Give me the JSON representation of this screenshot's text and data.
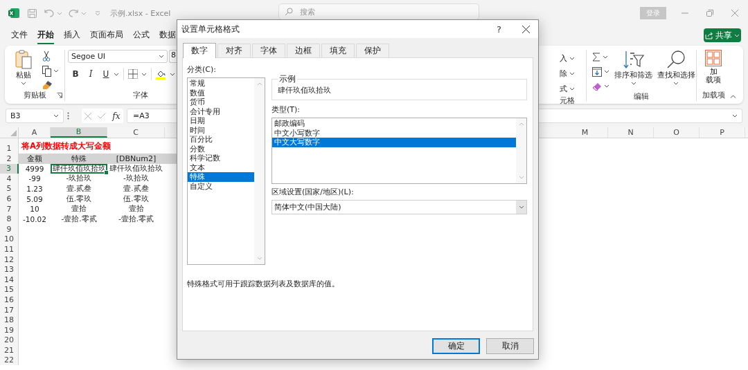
{
  "title_bar": {
    "file_title": "示例.xlsx - Excel",
    "search": {
      "placeholder": "搜索"
    },
    "sign_in_button": "登录"
  },
  "ribbon_tabs": [
    {
      "label": "文件",
      "selected": false
    },
    {
      "label": "开始",
      "selected": true
    },
    {
      "label": "插入",
      "selected": false
    },
    {
      "label": "页面布局",
      "selected": false
    },
    {
      "label": "公式",
      "selected": false
    },
    {
      "label": "数据",
      "selected": false
    }
  ],
  "share_button": "共享",
  "ribbon": {
    "clipboard": {
      "paste_button": "粘贴",
      "label": "剪贴板"
    },
    "font": {
      "font_name": "Segoe UI",
      "font_size": "8",
      "bold_button": "B",
      "italic_button": "I",
      "underline_button": "U",
      "label": "字体"
    },
    "cells": {
      "buttons": [
        "入",
        "除",
        "式"
      ],
      "label": "元格"
    },
    "editing": {
      "sort_filter_button": "排序和筛选",
      "find_select_button": "查找和选择",
      "label": "编辑"
    },
    "addins": {
      "button_lines": [
        "加",
        "载项"
      ],
      "label": "加载项"
    }
  },
  "formula_bar": {
    "name_box": "B3",
    "fx_button": "fx",
    "formula": "=A3"
  },
  "sheet": {
    "columns_left": [
      {
        "label": "A",
        "selected": false
      },
      {
        "label": "B",
        "selected": true
      },
      {
        "label": "C",
        "selected": false
      }
    ],
    "columns_right": [
      {
        "label": "M",
        "selected": false
      },
      {
        "label": "N",
        "selected": false
      },
      {
        "label": "O",
        "selected": false
      },
      {
        "label": "P",
        "selected": false
      }
    ],
    "rows": [
      {
        "number": "1",
        "selected": false,
        "kind": "title",
        "title": "将A列数据转成大写金额"
      },
      {
        "number": "2",
        "selected": false,
        "kind": "header",
        "cells": [
          {
            "text": "金额",
            "selected": false
          },
          {
            "text": "特殊",
            "selected": false
          },
          {
            "text": "[DBNum2]",
            "selected": false
          }
        ]
      },
      {
        "number": "3",
        "selected": true,
        "kind": "data",
        "cells": [
          {
            "text": "4999",
            "selected": false
          },
          {
            "text": "肆仟玖佰玖拾玖",
            "selected": true
          },
          {
            "text": "肆仟玖佰玖拾玖",
            "selected": false
          }
        ]
      },
      {
        "number": "4",
        "selected": false,
        "kind": "data",
        "cells": [
          {
            "text": "-99",
            "selected": false
          },
          {
            "text": "-玖拾玖",
            "selected": false
          },
          {
            "text": "-玖拾玖",
            "selected": false
          }
        ]
      },
      {
        "number": "5",
        "selected": false,
        "kind": "data",
        "cells": [
          {
            "text": "1.23",
            "selected": false
          },
          {
            "text": "壹.贰叁",
            "selected": false
          },
          {
            "text": "壹.贰叁",
            "selected": false
          }
        ]
      },
      {
        "number": "6",
        "selected": false,
        "kind": "data",
        "cells": [
          {
            "text": "5.09",
            "selected": false
          },
          {
            "text": "伍.零玖",
            "selected": false
          },
          {
            "text": "伍.零玖",
            "selected": false
          }
        ]
      },
      {
        "number": "7",
        "selected": false,
        "kind": "data",
        "cells": [
          {
            "text": "10",
            "selected": false
          },
          {
            "text": "壹拾",
            "selected": false
          },
          {
            "text": "壹拾",
            "selected": false
          }
        ]
      },
      {
        "number": "8",
        "selected": false,
        "kind": "data",
        "cells": [
          {
            "text": "-10.02",
            "selected": false
          },
          {
            "text": "-壹拾.零贰",
            "selected": false
          },
          {
            "text": "-壹拾.零贰",
            "selected": false
          }
        ]
      },
      {
        "number": "9",
        "selected": false,
        "kind": "empty"
      },
      {
        "number": "10",
        "selected": false,
        "kind": "empty"
      },
      {
        "number": "11",
        "selected": false,
        "kind": "empty"
      },
      {
        "number": "12",
        "selected": false,
        "kind": "empty"
      },
      {
        "number": "13",
        "selected": false,
        "kind": "empty"
      },
      {
        "number": "14",
        "selected": false,
        "kind": "empty"
      },
      {
        "number": "15",
        "selected": false,
        "kind": "empty"
      },
      {
        "number": "16",
        "selected": false,
        "kind": "empty"
      },
      {
        "number": "17",
        "selected": false,
        "kind": "empty"
      },
      {
        "number": "18",
        "selected": false,
        "kind": "empty"
      },
      {
        "number": "19",
        "selected": false,
        "kind": "empty"
      },
      {
        "number": "20",
        "selected": false,
        "kind": "empty"
      },
      {
        "number": "21",
        "selected": false,
        "kind": "empty"
      },
      {
        "number": "22",
        "selected": false,
        "kind": "empty"
      }
    ]
  },
  "dialog": {
    "title": "设置单元格格式",
    "help_button": "?",
    "tabs": [
      {
        "label": "数字",
        "selected": true
      },
      {
        "label": "对齐",
        "selected": false
      },
      {
        "label": "字体",
        "selected": false
      },
      {
        "label": "边框",
        "selected": false
      },
      {
        "label": "填充",
        "selected": false
      },
      {
        "label": "保护",
        "selected": false
      }
    ],
    "category_label": "分类(C):",
    "categories": [
      {
        "label": "常规",
        "selected": false
      },
      {
        "label": "数值",
        "selected": false
      },
      {
        "label": "货币",
        "selected": false
      },
      {
        "label": "会计专用",
        "selected": false
      },
      {
        "label": "日期",
        "selected": false
      },
      {
        "label": "时间",
        "selected": false
      },
      {
        "label": "百分比",
        "selected": false
      },
      {
        "label": "分数",
        "selected": false
      },
      {
        "label": "科学记数",
        "selected": false
      },
      {
        "label": "文本",
        "selected": false
      },
      {
        "label": "特殊",
        "selected": true
      },
      {
        "label": "自定义",
        "selected": false
      }
    ],
    "sample_label": "示例",
    "sample": "肆仟玖佰玖拾玖",
    "type_label": "类型(T):",
    "types": [
      {
        "label": "邮政编码",
        "selected": false
      },
      {
        "label": "中文小写数字",
        "selected": false
      },
      {
        "label": "中文大写数字",
        "selected": true
      }
    ],
    "locale_label": "区域设置(国家/地区)(L):",
    "locale": "简体中文(中国大陆)",
    "description": "特殊格式可用于跟踪数据列表及数据库的值。",
    "buttons": [
      {
        "label": "确定",
        "default": true
      },
      {
        "label": "取消",
        "default": false
      }
    ]
  }
}
